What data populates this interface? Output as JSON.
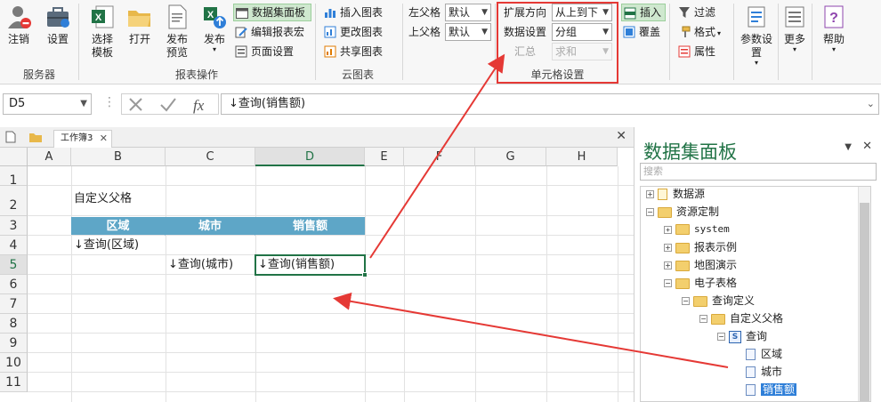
{
  "ribbon": {
    "logout": "注销",
    "settings": "设置",
    "group_server": "服务器",
    "select_template_1": "选择",
    "select_template_2": "模板",
    "open": "打开",
    "publish_preview_1": "发布",
    "publish_preview_2": "预览",
    "publish": "发布",
    "dataset_panel": "数据集面板",
    "edit_macro": "编辑报表宏",
    "page_setup": "页面设置",
    "group_report_ops": "报表操作",
    "insert_chart": "插入图表",
    "change_chart": "更改图表",
    "share_chart": "共享图表",
    "group_cloud_chart": "云图表",
    "left_parent_label": "左父格",
    "left_parent_value": "默认",
    "top_parent_label": "上父格",
    "top_parent_value": "默认",
    "expand_dir_label": "扩展方向",
    "expand_dir_value": "从上到下",
    "data_setting_label": "数据设置",
    "data_setting_value": "分组",
    "summary_label": "汇总",
    "summary_value": "求和",
    "group_cell_settings": "单元格设置",
    "insert": "插入",
    "overwrite": "覆盖",
    "filter": "过滤",
    "format": "格式",
    "properties": "属性",
    "param_settings": "参数设置",
    "more": "更多",
    "help": "帮助"
  },
  "formula_bar": {
    "name_box": "D5",
    "formula": "↓查询(销售额)"
  },
  "workbook": {
    "tab_name": "工作簿3",
    "columns": [
      "A",
      "B",
      "C",
      "D",
      "E",
      "F",
      "G",
      "H"
    ],
    "rows": [
      "1",
      "2",
      "3",
      "4",
      "5",
      "6",
      "7",
      "8",
      "9",
      "10",
      "11"
    ],
    "cells": {
      "b2": "自定义父格",
      "b3": "区域",
      "c3": "城市",
      "d3": "销售额",
      "b4": "↓查询(区域)",
      "c5": "↓查询(城市)",
      "d5": "↓查询(销售额)"
    }
  },
  "panel": {
    "title": "数据集面板",
    "search_placeholder": "搜索",
    "tree": {
      "datasource": "数据源",
      "resource_custom": "资源定制",
      "system": "system",
      "report_samples": "报表示例",
      "map_demo": "地图演示",
      "spreadsheet": "电子表格",
      "query_def": "查询定义",
      "custom_parent": "自定义父格",
      "query": "查询",
      "region": "区域",
      "city": "城市",
      "sales": "销售额"
    }
  },
  "colors": {
    "accent_green": "#217346",
    "header_fill": "#5ea6c7",
    "annotation_red": "#e53935",
    "tree_highlight": "#2f7fd8"
  }
}
